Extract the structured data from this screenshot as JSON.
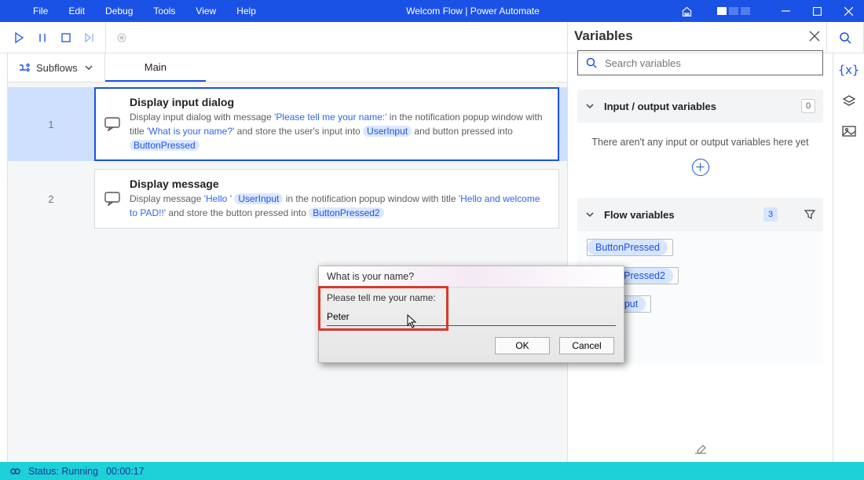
{
  "title": "Welcom Flow | Power Automate",
  "menus": [
    "File",
    "Edit",
    "Debug",
    "Tools",
    "View",
    "Help"
  ],
  "subflows_label": "Subflows",
  "tab_main": "Main",
  "actions": [
    {
      "num": "1",
      "selected": true,
      "title": "Display input dialog",
      "prefix": "Display input dialog with message ",
      "str1": "'Please tell me your name:'",
      "mid1": " in the notification popup window with title ",
      "str2": "'What is your name?'",
      "mid2": " and store the user's input into ",
      "var1": "UserInput",
      "mid3": "  and button pressed into ",
      "var2": "ButtonPressed"
    },
    {
      "num": "2",
      "selected": false,
      "title": "Display message",
      "prefix": "Display message ",
      "str1": "'Hello '",
      "var1": "UserInput",
      "mid1": "  in the notification popup window with title ",
      "str2": "'Hello and welcome to PAD!!'",
      "mid2": " and store the button pressed into ",
      "var2": "ButtonPressed2"
    }
  ],
  "variables": {
    "heading": "Variables",
    "search_placeholder": "Search variables",
    "io_title": "Input / output variables",
    "io_count": "0",
    "io_empty": "There aren't any input or output variables here yet",
    "flow_title": "Flow variables",
    "flow_count": "3",
    "chips": [
      "ButtonPressed",
      "ButtonPressed2",
      "UserInput"
    ]
  },
  "status": {
    "label": "Status: Running",
    "time": "00:00:17"
  },
  "dialog": {
    "title": "What is your name?",
    "prompt": "Please tell me your name:",
    "value": "Peter",
    "ok": "OK",
    "cancel": "Cancel"
  }
}
